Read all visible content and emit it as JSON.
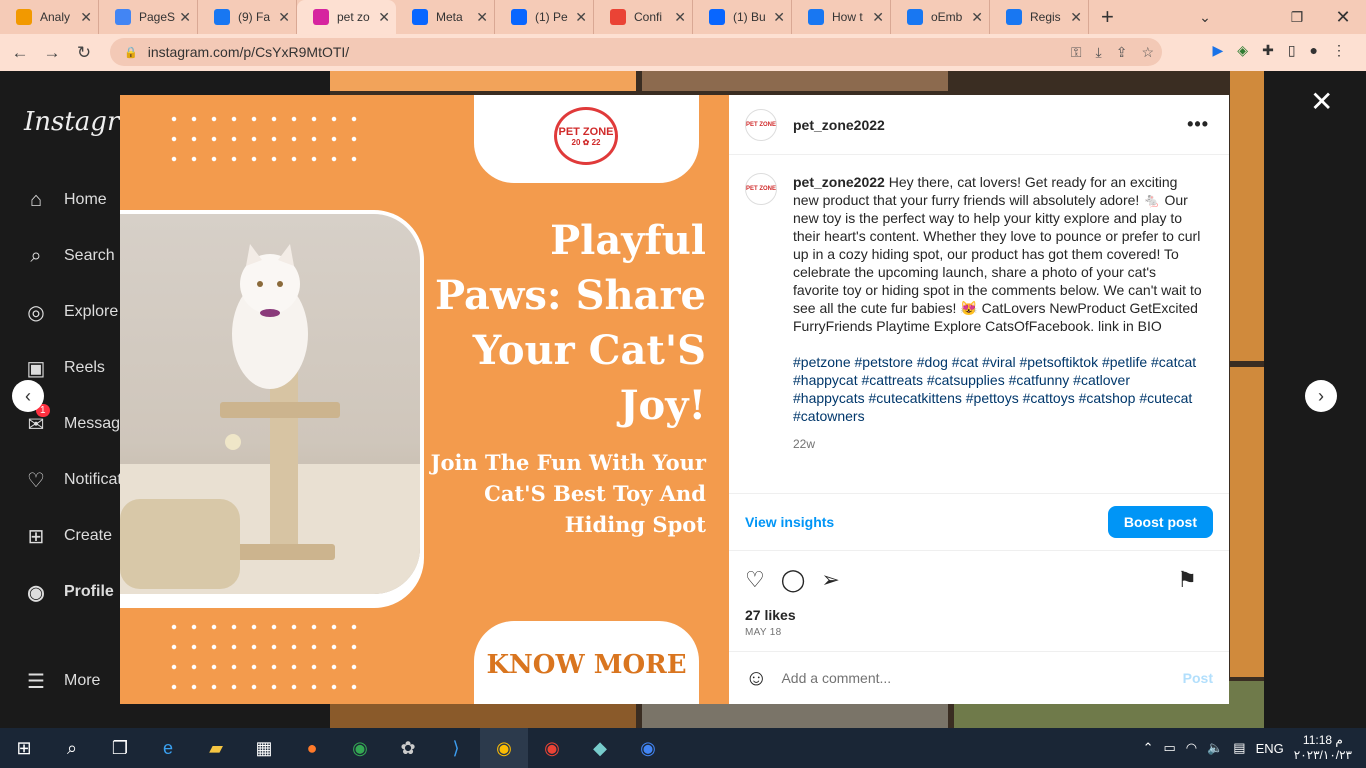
{
  "tabs": [
    {
      "label": "Analy",
      "favicon": "analytics-icon",
      "color": "#f29900"
    },
    {
      "label": "PageS",
      "favicon": "pagespeed-icon",
      "color": "#4285f4"
    },
    {
      "label": "(9) Fa",
      "favicon": "facebook-icon",
      "color": "#1877f2"
    },
    {
      "label": "pet zo",
      "favicon": "instagram-icon",
      "color": "#d6249f",
      "active": true
    },
    {
      "label": "Meta",
      "favicon": "meta-icon",
      "color": "#0866ff"
    },
    {
      "label": "(1) Pe",
      "favicon": "meta-icon",
      "color": "#0866ff"
    },
    {
      "label": "Confi",
      "favicon": "gmail-icon",
      "color": "#ea4335"
    },
    {
      "label": "(1) Bu",
      "favicon": "meta-icon",
      "color": "#0866ff"
    },
    {
      "label": "How t",
      "favicon": "facebook-dev-icon",
      "color": "#1877f2"
    },
    {
      "label": "oEmb",
      "favicon": "facebook-icon",
      "color": "#1877f2"
    },
    {
      "label": "Regis",
      "favicon": "facebook-icon",
      "color": "#1877f2"
    }
  ],
  "browser": {
    "url": "instagram.com/p/CsYxR9MtOTI/",
    "new_tab": "+",
    "back": "←",
    "forward": "→",
    "reload": "↻"
  },
  "sidebar": {
    "logo": "Instagram",
    "items": [
      {
        "label": "Home",
        "icon": "home-icon",
        "glyph": "⌂"
      },
      {
        "label": "Search",
        "icon": "search-icon",
        "glyph": "⌕"
      },
      {
        "label": "Explore",
        "icon": "explore-icon",
        "glyph": "◎"
      },
      {
        "label": "Reels",
        "icon": "reels-icon",
        "glyph": "▣"
      },
      {
        "label": "Messages",
        "icon": "messenger-icon",
        "glyph": "✉",
        "badge": "1"
      },
      {
        "label": "Notifications",
        "icon": "heart-icon",
        "glyph": "♡"
      },
      {
        "label": "Create",
        "icon": "plus-square-icon",
        "glyph": "⊞"
      },
      {
        "label": "Profile",
        "icon": "profile-avatar-icon",
        "glyph": "◉"
      },
      {
        "label": "More",
        "icon": "menu-icon",
        "glyph": "☰"
      }
    ]
  },
  "post_image": {
    "brand": "PET ZONE",
    "brand_year_left": "20",
    "brand_year_right": "22",
    "headline": "Playful Paws: Share Your Cat'S Joy!",
    "subline": "Join The Fun With Your Cat'S Best Toy And Hiding Spot",
    "cta": "KNOW MORE"
  },
  "post": {
    "username": "pet_zone2022",
    "avatar_text": "PET ZONE",
    "caption": "Hey there, cat lovers! Get ready for an exciting new product that your furry friends will absolutely adore! 🐁 Our new toy is the perfect way to help your kitty explore and play to their heart's content. Whether they love to pounce or prefer to curl up in a cozy hiding spot, our product has got them covered! To celebrate the upcoming launch, share a photo of your cat's favorite toy or hiding spot in the comments below. We can't wait to see all the cute fur babies! 😻 CatLovers NewProduct GetExcited FurryFriends Playtime Explore CatsOfFacebook. link in BIO",
    "hashtags": "#petzone #petstore #dog #cat #viral #petsoftiktok #petlife #catcat #happycat #cattreats #catsupplies #catfunny #catlover #happycats #cutecatkittens #pettoys #cattoys #catshop #cutecat #catowners",
    "time_ago": "22w",
    "view_insights": "View insights",
    "boost": "Boost post",
    "likes": "27 likes",
    "date": "MAY 18",
    "comment_placeholder": "Add a comment...",
    "post_btn": "Post"
  },
  "taskbar": {
    "lang": "ENG",
    "time": "11:18 م",
    "date": "٢٠٢٣/١٠/٢٣"
  }
}
